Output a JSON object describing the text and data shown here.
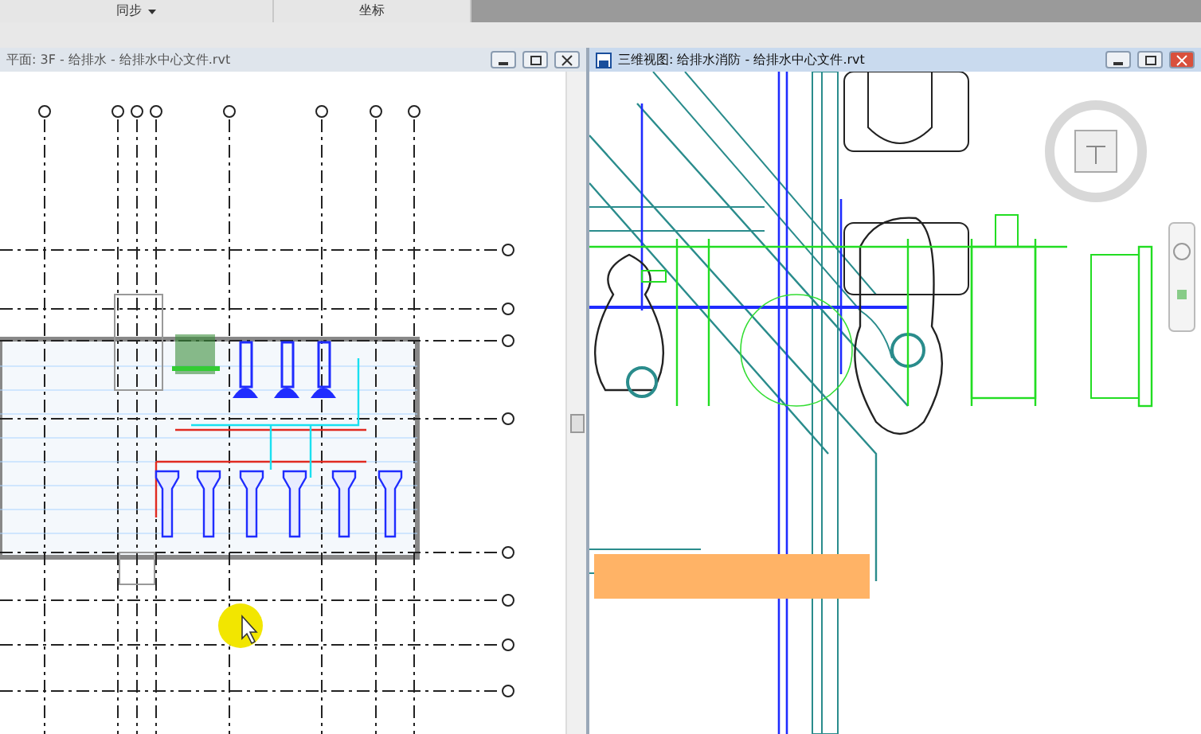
{
  "ribbon_panels": [
    {
      "label": "同步",
      "dropdown": true
    },
    {
      "label": "坐标",
      "dropdown": false
    }
  ],
  "windows": [
    {
      "title": "平面: 3F - 给排水 - 给排水中心文件.rvt",
      "active": false,
      "kind": "plan"
    },
    {
      "title": "三维视图: 给排水消防 - 给排水中心文件.rvt",
      "active": true,
      "kind": "perspective"
    }
  ]
}
